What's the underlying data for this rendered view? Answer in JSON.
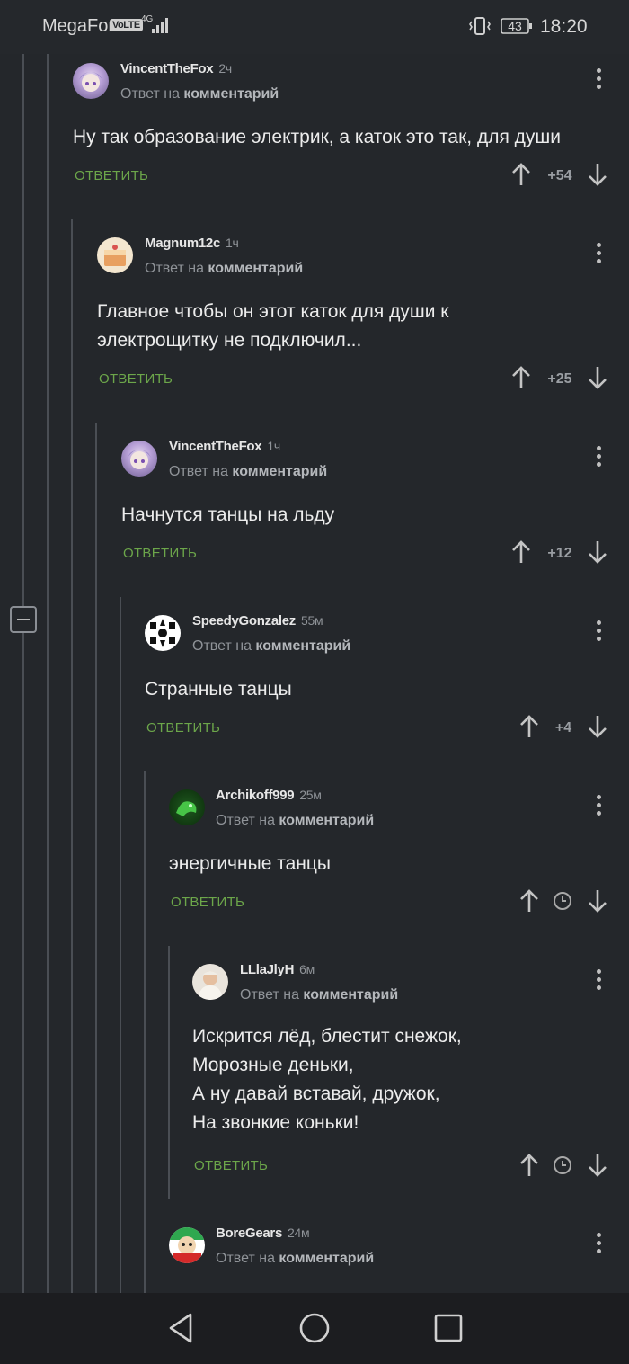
{
  "status_bar": {
    "carrier": "MegaFon",
    "volte": "VoLTE",
    "network": "4G",
    "battery": "43",
    "time": "18:20"
  },
  "comments": [
    {
      "username": "VincentTheFox",
      "time": "2ч",
      "reply_to_prefix": "Ответ на",
      "reply_to_link": "комментарий",
      "text_lines": [
        "Ну так образование электрик, а каток это так, для души"
      ],
      "reply_label": "ОТВЕТИТЬ",
      "rating": "+54",
      "avatar": "anime-avatar"
    },
    {
      "username": "Magnum12c",
      "time": "1ч",
      "reply_to_prefix": "Ответ на",
      "reply_to_link": "комментарий",
      "text_lines": [
        "Главное чтобы он этот каток для души к",
        "электрощитку не подключил..."
      ],
      "reply_label": "ОТВЕТИТЬ",
      "rating": "+25",
      "avatar": "cake-avatar"
    },
    {
      "username": "VincentTheFox",
      "time": "1ч",
      "reply_to_prefix": "Ответ на",
      "reply_to_link": "комментарий",
      "text_lines": [
        "Начнутся танцы на льду"
      ],
      "reply_label": "ОТВЕТИТЬ",
      "rating": "+12",
      "avatar": "anime-avatar"
    },
    {
      "username": "SpeedyGonzalez",
      "time": "55м",
      "reply_to_prefix": "Ответ на",
      "reply_to_link": "комментарий",
      "text_lines": [
        "Странные танцы"
      ],
      "reply_label": "ОТВЕТИТЬ",
      "rating": "+4",
      "avatar": "pattern-avatar"
    },
    {
      "username": "Archikoff999",
      "time": "25м",
      "reply_to_prefix": "Ответ на",
      "reply_to_link": "комментарий",
      "text_lines": [
        "энергичные танцы"
      ],
      "reply_label": "ОТВЕТИТЬ",
      "rating_icon": "clock-icon",
      "avatar": "green-dragon-avatar"
    },
    {
      "username": "LLlaJlyH",
      "time": "6м",
      "reply_to_prefix": "Ответ на",
      "reply_to_link": "комментарий",
      "text_lines": [
        "Искрится лёд, блестит снежок,",
        "Морозные деньки,",
        "А ну давай вставай, дружок,",
        "На звонкие коньки!"
      ],
      "reply_label": "ОТВЕТИТЬ",
      "rating_icon": "clock-icon",
      "avatar": "portrait-avatar"
    },
    {
      "username": "BoreGears",
      "time": "24м",
      "reply_to_prefix": "Ответ на",
      "reply_to_link": "комментарий",
      "text_lines": [],
      "avatar": "cartoon-avatar"
    }
  ],
  "colors": {
    "background": "#24272b",
    "reply_button": "#6ca64a",
    "thread_line": "#4a4e54",
    "nav_bar": "#1c1d20"
  },
  "nav_bar": {
    "icons": [
      "back-icon",
      "home-icon",
      "recent-apps-icon"
    ]
  }
}
